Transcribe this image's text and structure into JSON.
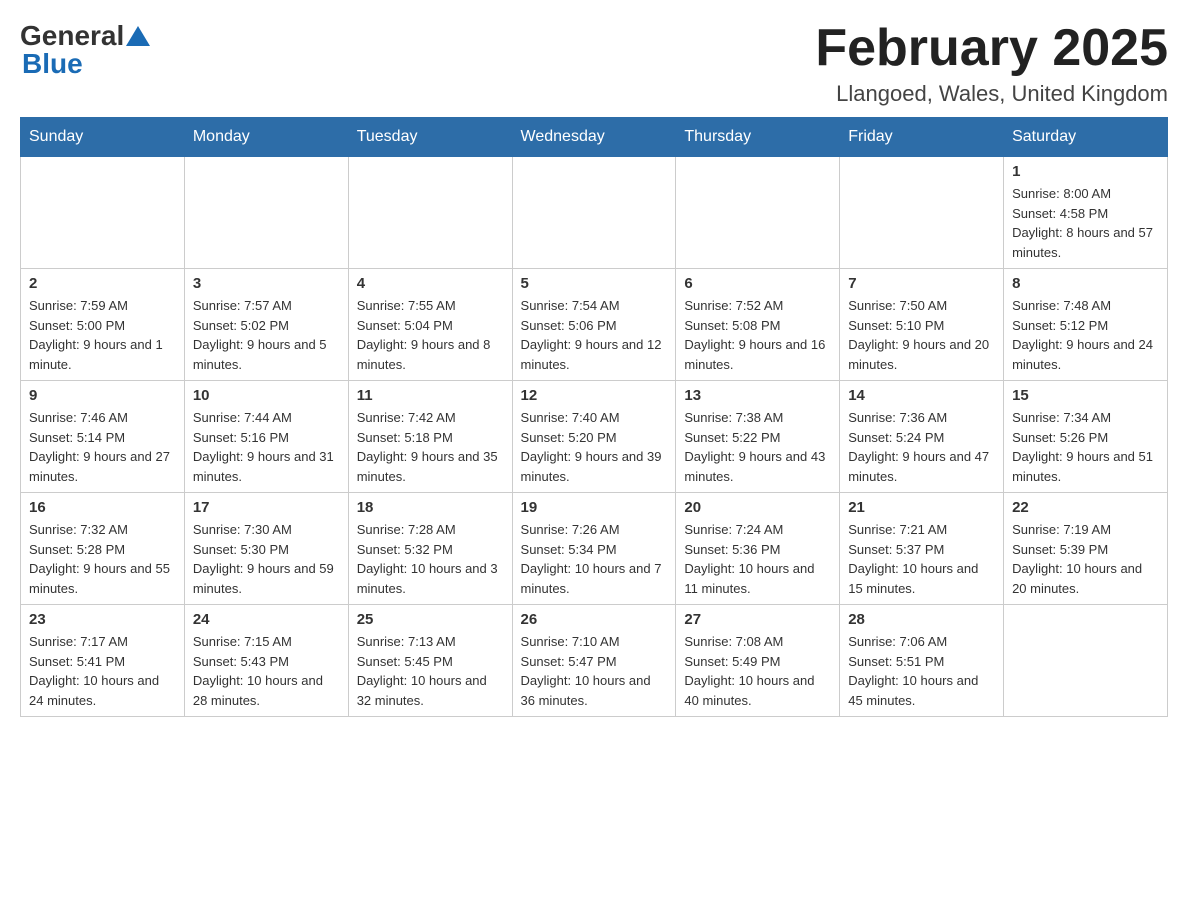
{
  "logo": {
    "general": "General",
    "blue": "Blue"
  },
  "title": "February 2025",
  "location": "Llangoed, Wales, United Kingdom",
  "weekdays": [
    "Sunday",
    "Monday",
    "Tuesday",
    "Wednesday",
    "Thursday",
    "Friday",
    "Saturday"
  ],
  "weeks": [
    [
      {
        "day": "",
        "info": ""
      },
      {
        "day": "",
        "info": ""
      },
      {
        "day": "",
        "info": ""
      },
      {
        "day": "",
        "info": ""
      },
      {
        "day": "",
        "info": ""
      },
      {
        "day": "",
        "info": ""
      },
      {
        "day": "1",
        "info": "Sunrise: 8:00 AM\nSunset: 4:58 PM\nDaylight: 8 hours and 57 minutes."
      }
    ],
    [
      {
        "day": "2",
        "info": "Sunrise: 7:59 AM\nSunset: 5:00 PM\nDaylight: 9 hours and 1 minute."
      },
      {
        "day": "3",
        "info": "Sunrise: 7:57 AM\nSunset: 5:02 PM\nDaylight: 9 hours and 5 minutes."
      },
      {
        "day": "4",
        "info": "Sunrise: 7:55 AM\nSunset: 5:04 PM\nDaylight: 9 hours and 8 minutes."
      },
      {
        "day": "5",
        "info": "Sunrise: 7:54 AM\nSunset: 5:06 PM\nDaylight: 9 hours and 12 minutes."
      },
      {
        "day": "6",
        "info": "Sunrise: 7:52 AM\nSunset: 5:08 PM\nDaylight: 9 hours and 16 minutes."
      },
      {
        "day": "7",
        "info": "Sunrise: 7:50 AM\nSunset: 5:10 PM\nDaylight: 9 hours and 20 minutes."
      },
      {
        "day": "8",
        "info": "Sunrise: 7:48 AM\nSunset: 5:12 PM\nDaylight: 9 hours and 24 minutes."
      }
    ],
    [
      {
        "day": "9",
        "info": "Sunrise: 7:46 AM\nSunset: 5:14 PM\nDaylight: 9 hours and 27 minutes."
      },
      {
        "day": "10",
        "info": "Sunrise: 7:44 AM\nSunset: 5:16 PM\nDaylight: 9 hours and 31 minutes."
      },
      {
        "day": "11",
        "info": "Sunrise: 7:42 AM\nSunset: 5:18 PM\nDaylight: 9 hours and 35 minutes."
      },
      {
        "day": "12",
        "info": "Sunrise: 7:40 AM\nSunset: 5:20 PM\nDaylight: 9 hours and 39 minutes."
      },
      {
        "day": "13",
        "info": "Sunrise: 7:38 AM\nSunset: 5:22 PM\nDaylight: 9 hours and 43 minutes."
      },
      {
        "day": "14",
        "info": "Sunrise: 7:36 AM\nSunset: 5:24 PM\nDaylight: 9 hours and 47 minutes."
      },
      {
        "day": "15",
        "info": "Sunrise: 7:34 AM\nSunset: 5:26 PM\nDaylight: 9 hours and 51 minutes."
      }
    ],
    [
      {
        "day": "16",
        "info": "Sunrise: 7:32 AM\nSunset: 5:28 PM\nDaylight: 9 hours and 55 minutes."
      },
      {
        "day": "17",
        "info": "Sunrise: 7:30 AM\nSunset: 5:30 PM\nDaylight: 9 hours and 59 minutes."
      },
      {
        "day": "18",
        "info": "Sunrise: 7:28 AM\nSunset: 5:32 PM\nDaylight: 10 hours and 3 minutes."
      },
      {
        "day": "19",
        "info": "Sunrise: 7:26 AM\nSunset: 5:34 PM\nDaylight: 10 hours and 7 minutes."
      },
      {
        "day": "20",
        "info": "Sunrise: 7:24 AM\nSunset: 5:36 PM\nDaylight: 10 hours and 11 minutes."
      },
      {
        "day": "21",
        "info": "Sunrise: 7:21 AM\nSunset: 5:37 PM\nDaylight: 10 hours and 15 minutes."
      },
      {
        "day": "22",
        "info": "Sunrise: 7:19 AM\nSunset: 5:39 PM\nDaylight: 10 hours and 20 minutes."
      }
    ],
    [
      {
        "day": "23",
        "info": "Sunrise: 7:17 AM\nSunset: 5:41 PM\nDaylight: 10 hours and 24 minutes."
      },
      {
        "day": "24",
        "info": "Sunrise: 7:15 AM\nSunset: 5:43 PM\nDaylight: 10 hours and 28 minutes."
      },
      {
        "day": "25",
        "info": "Sunrise: 7:13 AM\nSunset: 5:45 PM\nDaylight: 10 hours and 32 minutes."
      },
      {
        "day": "26",
        "info": "Sunrise: 7:10 AM\nSunset: 5:47 PM\nDaylight: 10 hours and 36 minutes."
      },
      {
        "day": "27",
        "info": "Sunrise: 7:08 AM\nSunset: 5:49 PM\nDaylight: 10 hours and 40 minutes."
      },
      {
        "day": "28",
        "info": "Sunrise: 7:06 AM\nSunset: 5:51 PM\nDaylight: 10 hours and 45 minutes."
      },
      {
        "day": "",
        "info": ""
      }
    ]
  ]
}
